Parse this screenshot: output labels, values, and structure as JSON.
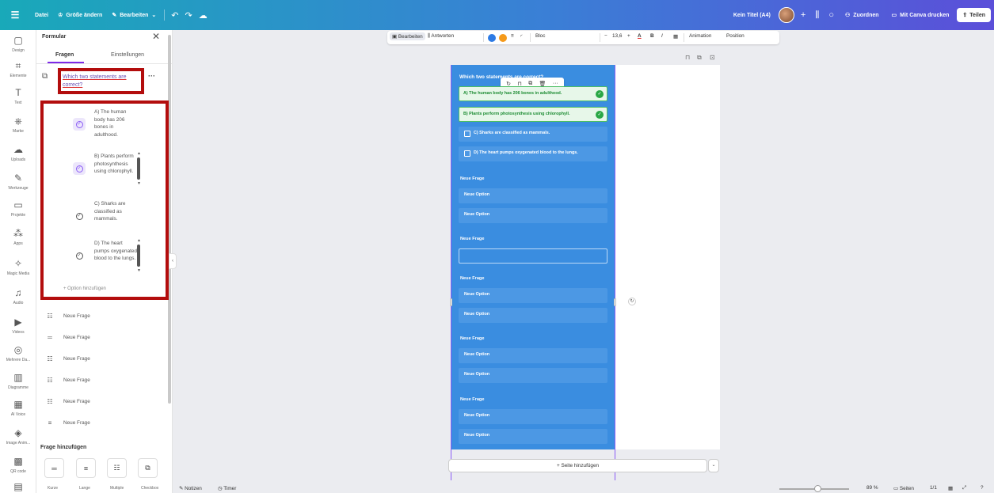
{
  "topbar": {
    "menu_icon": "hamburger-icon",
    "datei": "Datei",
    "resize": "Größe ändern",
    "edit": "Bearbeiten",
    "title": "Kein Titel (A4)",
    "assign": "Zuordnen",
    "print": "Mit Canva drucken",
    "share": "Teilen"
  },
  "rail": [
    {
      "icon": "▢",
      "label": "Design"
    },
    {
      "icon": "⌗",
      "label": "Elemente"
    },
    {
      "icon": "T",
      "label": "Text"
    },
    {
      "icon": "⎈",
      "label": "Marke"
    },
    {
      "icon": "☁",
      "label": "Uploads"
    },
    {
      "icon": "✎",
      "label": "Werkzeuge"
    },
    {
      "icon": "▭",
      "label": "Projekte"
    },
    {
      "icon": "⁂",
      "label": "Apps"
    },
    {
      "icon": "✧",
      "label": "Magic Media"
    },
    {
      "icon": "♫",
      "label": "Audio"
    },
    {
      "icon": "▶",
      "label": "Videos"
    },
    {
      "icon": "◎",
      "label": "Mehrere Da..."
    },
    {
      "icon": "▥",
      "label": "Diagramme"
    },
    {
      "icon": "▦",
      "label": "AI Voice"
    },
    {
      "icon": "◈",
      "label": "Image Anim..."
    },
    {
      "icon": "▩",
      "label": "QR code"
    },
    {
      "icon": "▤",
      "label": ""
    }
  ],
  "panel": {
    "title": "Formular",
    "tab_questions": "Fragen",
    "tab_settings": "Einstellungen",
    "question": "Which two statements are correct?",
    "options": [
      {
        "text": "A) The human body has 206 bones in adulthood.",
        "checked": true
      },
      {
        "text": "B) Plants perform photosynthesis using chlorophyll.",
        "checked": true
      },
      {
        "text": "C) Sharks are classified as mammals.",
        "checked": false
      },
      {
        "text": "D) The heart pumps oxygenated blood to the lungs.",
        "checked": false
      }
    ],
    "add_option": "+ Option hinzufügen",
    "new_questions": [
      {
        "icon": "list-icon",
        "label": "Neue Frage"
      },
      {
        "icon": "short-text-icon",
        "label": "Neue Frage"
      },
      {
        "icon": "list-icon",
        "label": "Neue Frage"
      },
      {
        "icon": "list-icon",
        "label": "Neue Frage"
      },
      {
        "icon": "list-icon",
        "label": "Neue Frage"
      },
      {
        "icon": "long-text-icon",
        "label": "Neue Frage"
      }
    ],
    "add_question_heading": "Frage hinzufügen",
    "add_types": [
      "Kurze",
      "Lange",
      "Multiple",
      "Checkbox"
    ]
  },
  "toolbar": {
    "edit": "Bearbeiten",
    "answers": "Antworten",
    "colors": [
      "#2d7be5",
      "#f59a1b"
    ],
    "font": "Bloc",
    "font_size": "13,6",
    "minus": "−",
    "plus": "+",
    "bold": "B",
    "italic": "I",
    "animation": "Animation",
    "position": "Position"
  },
  "form": {
    "title": "Which two statements are correct?",
    "options": [
      {
        "text": "A) The human body has 206 bones in adulthood.",
        "correct": true
      },
      {
        "text": "B) Plants perform photosynthesis using chlorophyll.",
        "correct": true
      },
      {
        "text": "C) Sharks are classified as mammals.",
        "correct": false
      },
      {
        "text": "D) The heart pumps oxygenated blood to the lungs.",
        "correct": false
      }
    ],
    "new_question": "Neue Frage",
    "new_option": "Neue Option"
  },
  "add_page": "+ Seite hinzufügen",
  "bottom": {
    "notes": "Notizen",
    "timer": "Timer",
    "zoom": "89 %",
    "pages_label": "Seiten",
    "pages": "1/1",
    "zoom_level": 0.55
  }
}
